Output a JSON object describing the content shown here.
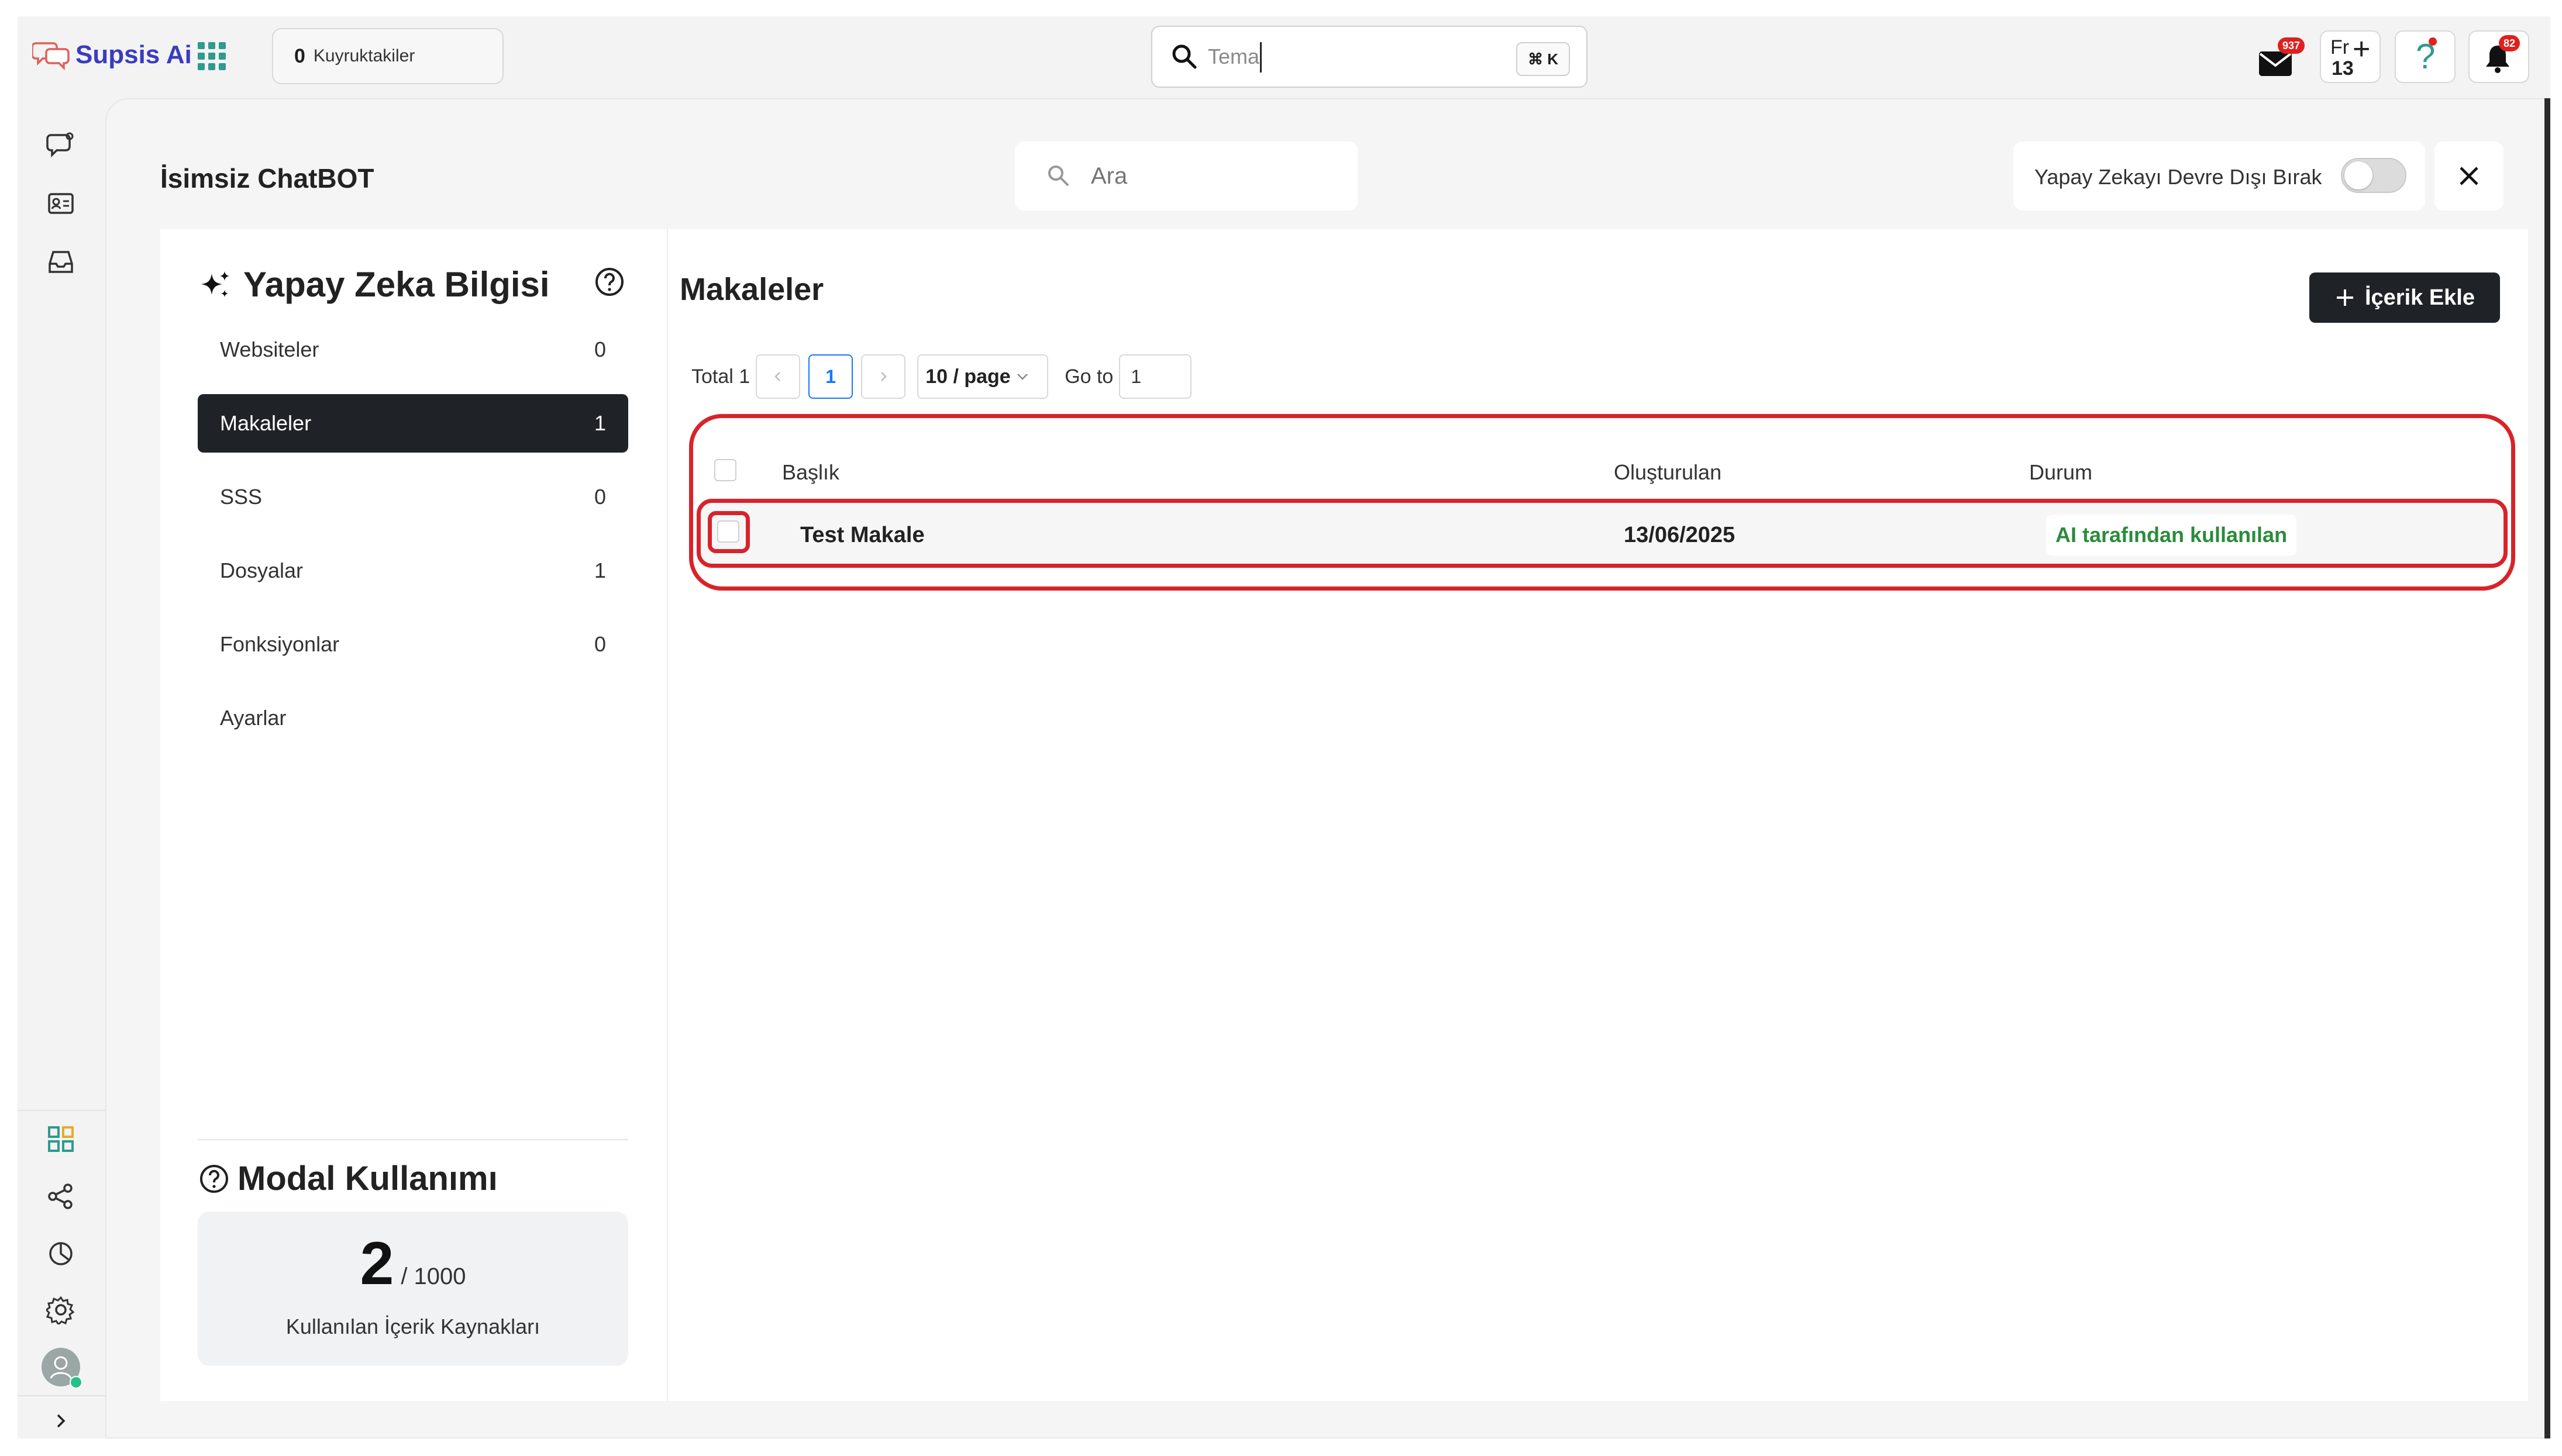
{
  "app": {
    "name": "Supsis Ai"
  },
  "topbar": {
    "queue_count": "0",
    "queue_label": "Kuyruktakiler",
    "search_value": "Tema",
    "search_shortcut": "⌘ K",
    "mail_badge": "937",
    "fr_label": "Fr",
    "fr_count": "13",
    "notif_badge": "82"
  },
  "page": {
    "title": "İsimsiz ChatBOT",
    "search_placeholder": "Ara",
    "ai_disable_label": "Yapay Zekayı Devre Dışı Bırak"
  },
  "knowledge": {
    "title": "Yapay Zeka Bilgisi",
    "items": [
      {
        "label": "Websiteler",
        "count": "0"
      },
      {
        "label": "Makaleler",
        "count": "1"
      },
      {
        "label": "SSS",
        "count": "0"
      },
      {
        "label": "Dosyalar",
        "count": "1"
      },
      {
        "label": "Fonksiyonlar",
        "count": "0"
      },
      {
        "label": "Ayarlar",
        "count": ""
      }
    ]
  },
  "usage": {
    "title": "Modal Kullanımı",
    "used": "2",
    "limit": "/ 1000",
    "label": "Kullanılan İçerik Kaynakları"
  },
  "articles": {
    "title": "Makaleler",
    "add_button": "İçerik Ekle",
    "pagination": {
      "total": "Total 1",
      "current_page": "1",
      "page_size": "10 / page",
      "goto_label": "Go to",
      "goto_value": "1"
    },
    "columns": [
      "Başlık",
      "Oluşturulan",
      "Durum"
    ],
    "rows": [
      {
        "title": "Test Makale",
        "created": "13/06/2025",
        "status": "AI tarafından kullanılan"
      }
    ]
  },
  "colors": {
    "brand": "#3b3bbf",
    "accent_dark": "#1f2327",
    "highlight_red": "#d8232a",
    "status_green": "#2a8c3b",
    "badge_red": "#e0201e"
  }
}
